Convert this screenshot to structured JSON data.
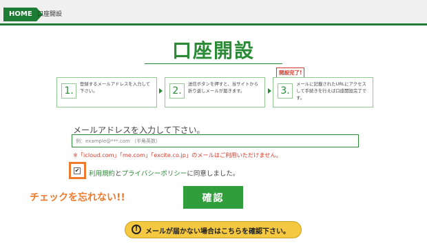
{
  "breadcrumb": {
    "home": "HOME",
    "current": "口座開設"
  },
  "title": "口座開設",
  "steps": [
    {
      "num": "1.",
      "text": "登録するメールアドレスを入力して下さい。"
    },
    {
      "num": "2.",
      "text": "送信ボタンを押すと、当サイトから折り返しメールが届きます。"
    },
    {
      "num": "3.",
      "text": "メールに記載されたURLにアクセスして手続きを行えば口座開設完了です。"
    }
  ],
  "badge": "開設完了!",
  "form": {
    "label": "メールアドレスを入力して下さい。",
    "placeholder": "例：example@***.com （半角英数）",
    "notice": "※「icloud.com」「me.com」「excite.co.jp」のメールはご利用いただけません。",
    "checkbox_mark": "✔",
    "agree_link1": "利用規約",
    "agree_and": "と",
    "agree_link2": "プライバシーポリシー",
    "agree_rest": "に同意しました。",
    "confirm": "確認"
  },
  "reminder": "チェックを忘れない!!",
  "help": {
    "icon": "!",
    "label": "メールが届かない場合はこちらを確認下さい。"
  },
  "colors": {
    "brand_green": "#1e7b34",
    "accent_orange": "#ef7a2e",
    "warning_red": "#d63a2c",
    "help_yellow": "#f5c842"
  }
}
